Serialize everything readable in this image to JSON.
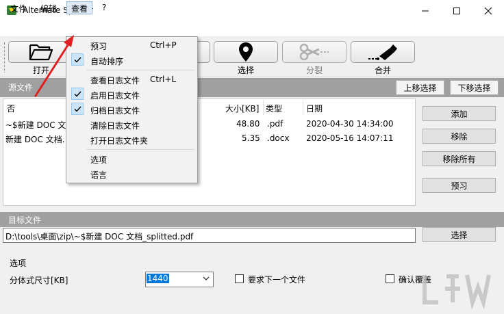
{
  "window": {
    "title": "Alternate Splitter"
  },
  "menubar": {
    "file": "文件",
    "edit": "编辑",
    "view": "查看",
    "help": "?"
  },
  "toolbar": {
    "open_label": "打开",
    "select_label": "选择",
    "split_label": "分裂",
    "merge_label": "合并"
  },
  "view_menu": {
    "preview": "预习",
    "preview_shortcut": "Ctrl+P",
    "auto_sort": "自动排序",
    "view_log": "查看日志文件",
    "view_log_shortcut": "Ctrl+L",
    "enable_log": "启用日志文件",
    "archive_log": "归档日志文件",
    "clear_log": "清除日志文件",
    "open_log_folder": "打开日志文件夹",
    "options": "选项",
    "language": "语言"
  },
  "source": {
    "title": "源文件",
    "move_up": "上移选择",
    "move_down": "下移选择",
    "columns": {
      "name": "否",
      "size": "大小[KB]",
      "type": "类型",
      "date": "日期"
    },
    "rows": [
      {
        "name": "~$新建 DOC 文",
        "size": "48.80",
        "type": ".pdf",
        "date": "2020-04-30 14:34:00"
      },
      {
        "name": "新建 DOC 文档.",
        "size": "5.35",
        "type": ".docx",
        "date": "2020-05-16 14:07:11"
      }
    ],
    "add": "添加",
    "remove": "移除",
    "remove_all": "移除所有",
    "preview": "预习"
  },
  "target": {
    "title": "目标文件",
    "path": "D:\\tools\\桌面\\zip\\~$新建 DOC 文档_splitted.pdf",
    "select": "选择"
  },
  "options": {
    "title": "选项",
    "split_size_label": "分体式尺寸[KB]",
    "split_size_value": "1440",
    "require_next_label": "要求下一个文件",
    "confirm_overwrite_label": "确认覆盖"
  },
  "colors": {
    "accent": "#0078d7",
    "panel_header": "#a0a0a0",
    "annotation_arrow": "#e02020"
  }
}
